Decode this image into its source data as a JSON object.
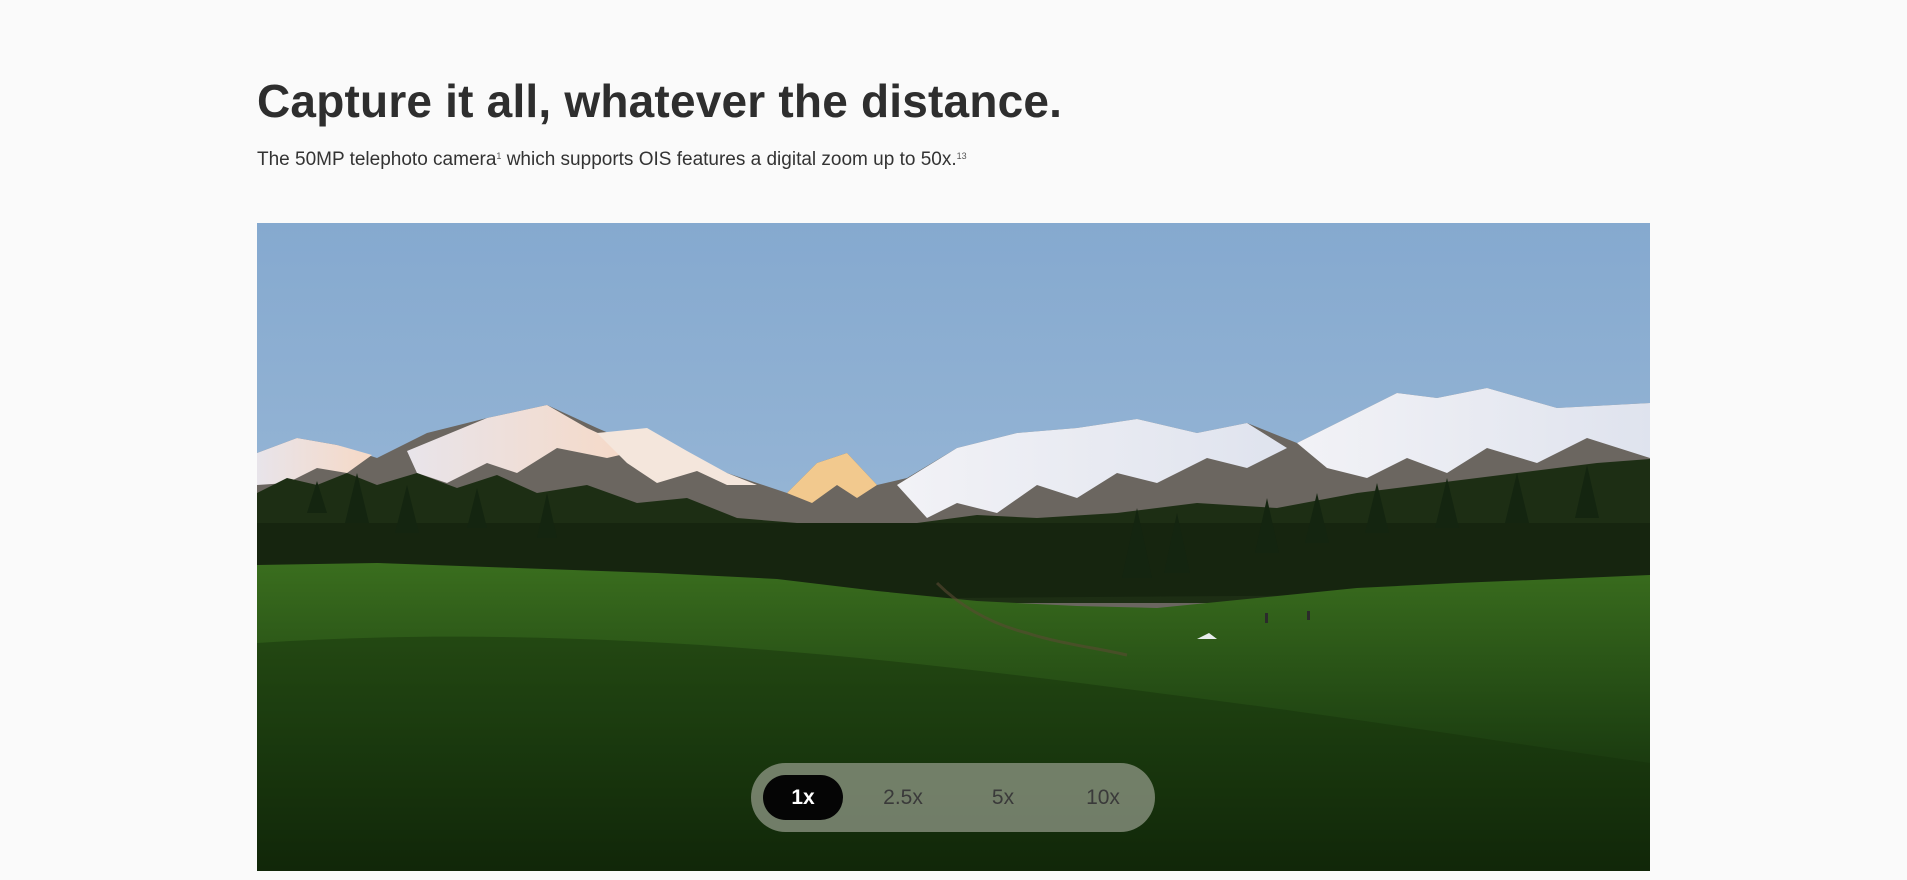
{
  "section": {
    "heading": "Capture it all, whatever the distance.",
    "subtitle_part1": "The 50MP telephoto camera",
    "footnote_1": "1",
    "subtitle_part2": " which supports OIS features a digital zoom up to 50x.",
    "footnote_2": "13"
  },
  "photo": {
    "subject": "mountain-meadow-landscape"
  },
  "zoom": {
    "options": [
      "1x",
      "2.5x",
      "5x",
      "10x"
    ],
    "selected": "1x"
  },
  "colors": {
    "background": "#fafafa",
    "text": "#2e2e2e",
    "active_pill": "#050505",
    "pill_track": "#969c8c"
  }
}
